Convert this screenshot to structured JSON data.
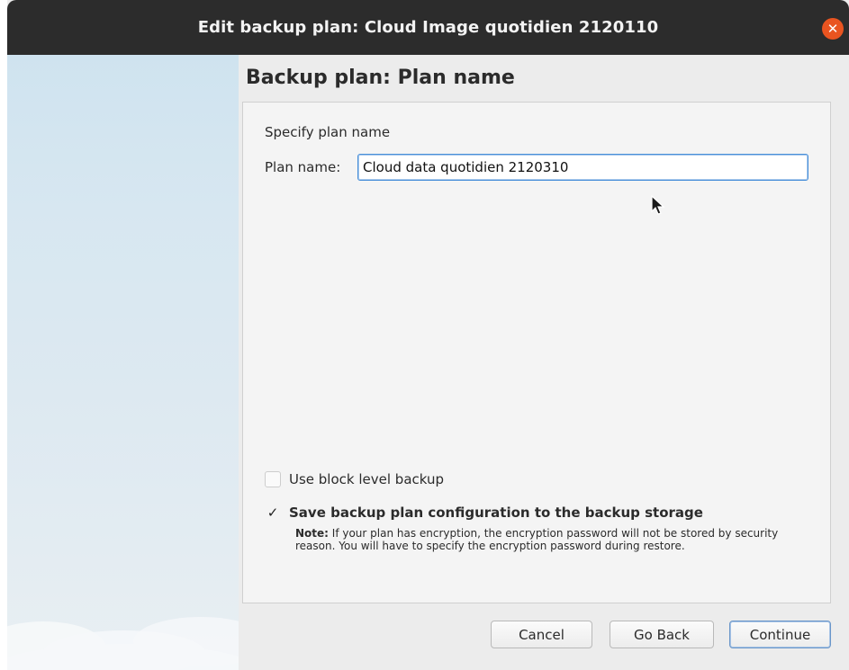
{
  "window": {
    "title": "Edit backup plan: Cloud Image quotidien 2120110",
    "close_glyph": "✕"
  },
  "page": {
    "heading": "Backup plan: Plan name",
    "section_label": "Specify plan name",
    "plan_name_label": "Plan name:",
    "plan_name_value": "Cloud data quotidien 2120310"
  },
  "options": {
    "block_level": {
      "label": "Use block level backup",
      "checked": false
    },
    "save_config": {
      "label": "Save backup plan configuration to the backup storage",
      "checked": true,
      "check_glyph": "✓",
      "note_prefix": "Note:",
      "note_text": " If your plan has encryption, the encryption password will not be stored by security reason. You will have to specify the encryption password during restore."
    }
  },
  "buttons": {
    "cancel": "Cancel",
    "go_back": "Go Back",
    "continue": "Continue"
  },
  "colors": {
    "titlebar": "#2c2c2c",
    "close_button": "#e95420",
    "focus_border": "#4a90d9"
  }
}
